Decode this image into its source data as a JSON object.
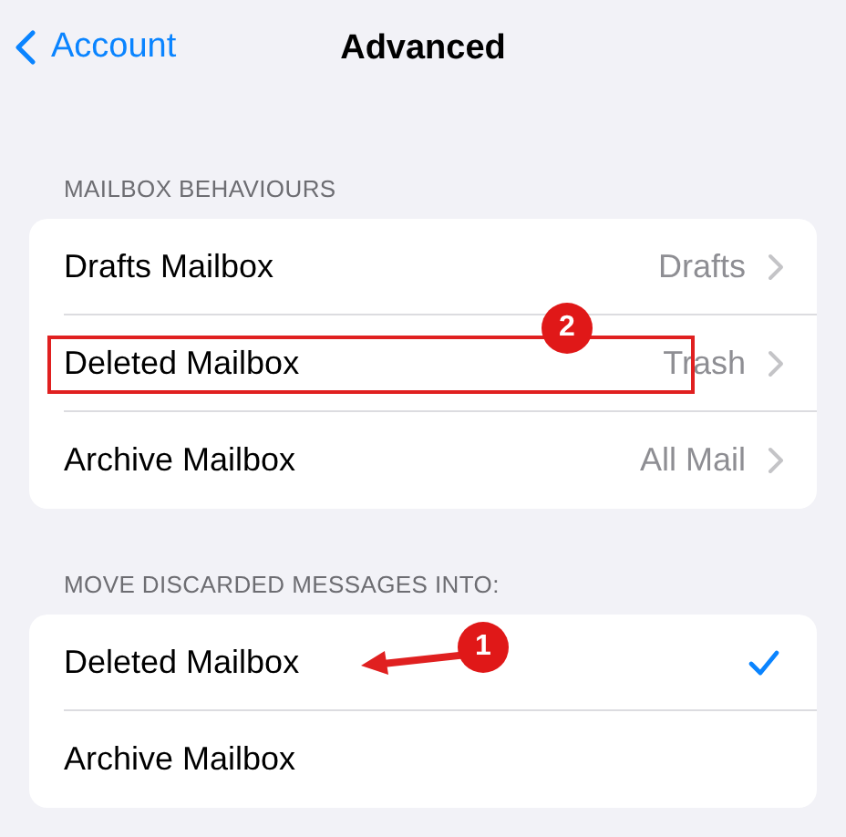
{
  "nav": {
    "back_label": "Account",
    "title": "Advanced"
  },
  "sections": [
    {
      "header": "MAILBOX BEHAVIOURS",
      "rows": [
        {
          "kind": "value",
          "label": "Drafts Mailbox",
          "value": "Drafts"
        },
        {
          "kind": "value",
          "label": "Deleted Mailbox",
          "value": "Trash",
          "highlighted": true,
          "annotation": {
            "kind": "badge",
            "label": "2"
          }
        },
        {
          "kind": "value",
          "label": "Archive Mailbox",
          "value": "All Mail"
        }
      ]
    },
    {
      "header": "MOVE DISCARDED MESSAGES INTO:",
      "rows": [
        {
          "kind": "choice",
          "label": "Deleted Mailbox",
          "selected": true,
          "annotation": {
            "kind": "arrow",
            "label": "1"
          }
        },
        {
          "kind": "choice",
          "label": "Archive Mailbox",
          "selected": false
        }
      ]
    }
  ]
}
